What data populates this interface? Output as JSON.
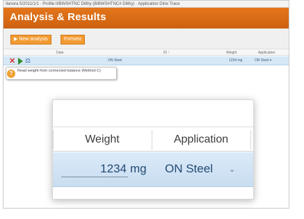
{
  "window": {
    "title_bar_text": "Ilanora 5/2011/1/1 · Profile Il/BWSHTNC Dilthy (B/BWSHTNC# Dilthy) · Application Ditre Trace"
  },
  "header": {
    "title": "Analysis & Results"
  },
  "toolbar": {
    "new_analysis_label": "New analysis",
    "save_label": "Fortsetz"
  },
  "table": {
    "columns": [
      "Date",
      "ID ↑",
      "Weight",
      "Application"
    ],
    "row": {
      "date": "",
      "id": "ON Steel",
      "weight": "1234 mg",
      "application": "ON Steel ▾"
    }
  },
  "tooltip": {
    "text": "Read weight from connected balance (Method C)"
  },
  "zoom": {
    "col_weight": "Weight",
    "col_application": "Application",
    "weight_value": "1234",
    "weight_unit": "mg",
    "application_value": "ON Steel"
  },
  "icons": {
    "delete": "x-icon",
    "start": "play-icon",
    "balance": "scale-icon",
    "help": "help-icon",
    "dropdown": "chevron-down-icon"
  },
  "colors": {
    "header_orange": "#e4761c",
    "button_orange": "#f29b33",
    "row_highlight": "#d6e8f6",
    "delete_red": "#d9302a",
    "start_green": "#2f8b2f"
  }
}
